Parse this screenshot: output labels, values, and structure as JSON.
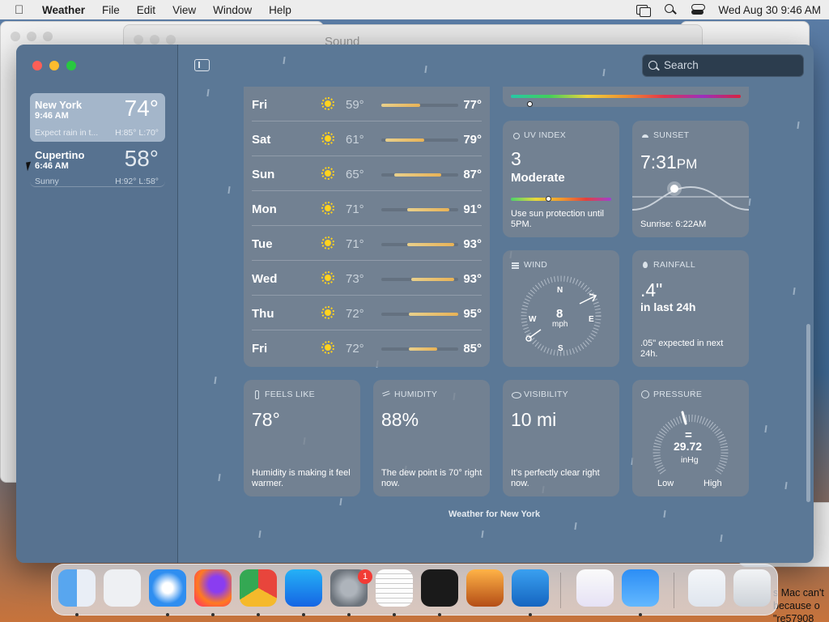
{
  "menubar": {
    "app": "Weather",
    "menus": [
      "File",
      "Edit",
      "View",
      "Window",
      "Help"
    ],
    "clock": "Wed Aug 30  9:46 AM"
  },
  "background": {
    "sound_window_title": "Sound",
    "notification_text": "s Mac can't because o \"re57908"
  },
  "search": {
    "placeholder": "Search"
  },
  "locations": [
    {
      "name": "New York",
      "time": "9:46 AM",
      "temp": "74°",
      "condition": "Expect rain in t...",
      "hl": "H:85°  L:70°"
    },
    {
      "name": "Cupertino",
      "time": "6:46 AM",
      "temp": "58°",
      "condition": "Sunny",
      "hl": "H:92°  L:58°"
    }
  ],
  "forecast": [
    {
      "day": "Fri",
      "lo": "59°",
      "hi": "77°",
      "icon": "sun-icon",
      "range": [
        59,
        77
      ]
    },
    {
      "day": "Sat",
      "lo": "61°",
      "hi": "79°",
      "icon": "sun-icon",
      "range": [
        61,
        79
      ]
    },
    {
      "day": "Sun",
      "lo": "65°",
      "hi": "87°",
      "icon": "sun-icon",
      "range": [
        65,
        87
      ]
    },
    {
      "day": "Mon",
      "lo": "71°",
      "hi": "91°",
      "icon": "sun-icon",
      "range": [
        71,
        91
      ]
    },
    {
      "day": "Tue",
      "lo": "71°",
      "hi": "93°",
      "icon": "sun-icon",
      "range": [
        71,
        93
      ]
    },
    {
      "day": "Wed",
      "lo": "73°",
      "hi": "93°",
      "icon": "sun-icon",
      "range": [
        73,
        93
      ]
    },
    {
      "day": "Thu",
      "lo": "72°",
      "hi": "95°",
      "icon": "sun-icon",
      "range": [
        72,
        95
      ]
    },
    {
      "day": "Fri",
      "lo": "72°",
      "hi": "85°",
      "icon": "sun-icon",
      "range": [
        72,
        85
      ]
    }
  ],
  "forecast_scale": {
    "min": 59,
    "max": 95
  },
  "tiles": {
    "uv": {
      "label": "UV INDEX",
      "value": "3",
      "level": "Moderate",
      "note": "Use sun protection until 5PM."
    },
    "sunset": {
      "label": "SUNSET",
      "value": "7:31",
      "ampm": "PM",
      "note": "Sunrise: 6:22AM"
    },
    "wind": {
      "label": "WIND",
      "speed": "8",
      "unit": "mph",
      "n": "N",
      "e": "E",
      "s": "S",
      "w": "W"
    },
    "rainfall": {
      "label": "RAINFALL",
      "value": ".4\"",
      "period": "in last 24h",
      "note": ".05\" expected in next 24h."
    },
    "feels_like": {
      "label": "FEELS LIKE",
      "value": "78°",
      "note": "Humidity is making it feel warmer."
    },
    "humidity": {
      "label": "HUMIDITY",
      "value": "88%",
      "note": "The dew point is 70° right now."
    },
    "visibility": {
      "label": "VISIBILITY",
      "value": "10 mi",
      "note": "It's perfectly clear right now."
    },
    "pressure": {
      "label": "PRESSURE",
      "trend": "=",
      "value": "29.72",
      "unit": "inHg",
      "low": "Low",
      "high": "High"
    }
  },
  "footer": "Weather for New York",
  "dock": {
    "items": [
      "finder-icon",
      "launchpad-icon",
      "safari-icon",
      "firefox-icon",
      "chrome-icon",
      "app-store-icon",
      "system-settings-icon",
      "textedit-icon",
      "terminal-icon",
      "garageband-icon",
      "vscode-icon",
      "visual-studio-icon",
      "weather-app-icon",
      "preview-icon",
      "trash-icon"
    ],
    "settings_badge": "1"
  }
}
